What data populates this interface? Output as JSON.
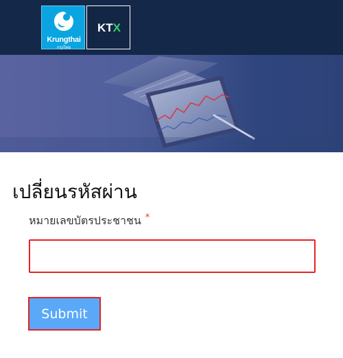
{
  "header": {
    "krungthai_logo": {
      "name": "Krungthai",
      "subtitle": "กรุงไทย",
      "color": "#0aa4e0"
    },
    "ktx_logo": {
      "prefix": "KT",
      "suffix": "X",
      "accent": "#2fd46a"
    },
    "background": "#14284a"
  },
  "banner": {
    "image": "laptop-tablet-stock-chart-photo"
  },
  "page": {
    "title": "เปลี่ยนรหัสผ่าน"
  },
  "form": {
    "id_label": "หมายเลขบัตรประชาชน",
    "required_mark": "*",
    "id_value": "",
    "submit_label": "Submit",
    "submit_color": "#5aa8f8"
  }
}
